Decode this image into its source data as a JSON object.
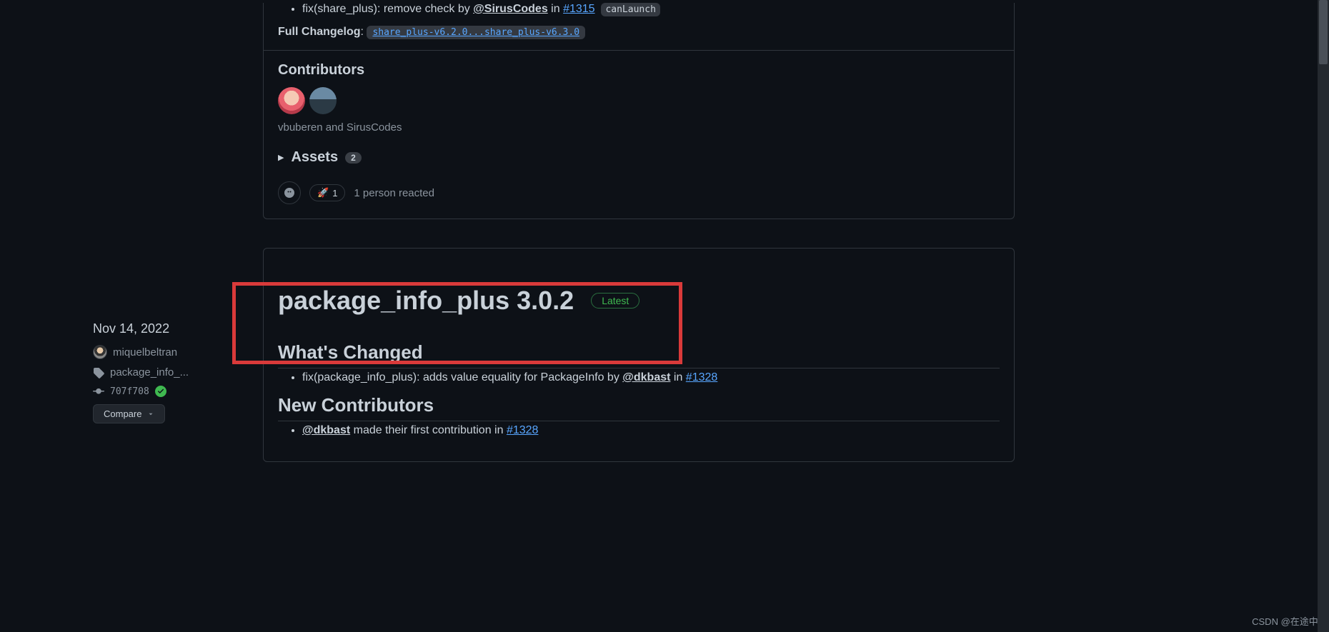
{
  "prev_release": {
    "items": [
      {
        "prefix": "fix(share_plus): remove check by ",
        "mention": "@SirusCodes",
        "in": " in ",
        "pr": "#1315",
        "chip": "canLaunch"
      }
    ],
    "changelog_label": "Full Changelog",
    "changelog_compare": "share_plus-v6.2.0...share_plus-v6.3.0",
    "contributors_heading": "Contributors",
    "contributors_names": "vbuberen and SirusCodes",
    "assets_label": "Assets",
    "assets_count": "2",
    "reaction_emoji": "🚀",
    "reaction_count": "1",
    "reaction_summary": "1 person reacted"
  },
  "sidebar": {
    "date": "Nov 14, 2022",
    "author": "miquelbeltran",
    "tag": "package_info_...",
    "sha": "707f708",
    "compare_label": "Compare"
  },
  "release": {
    "title": "package_info_plus 3.0.2",
    "latest_label": "Latest",
    "whats_changed": "What's Changed",
    "changed_items": [
      {
        "prefix": "fix(package_info_plus): adds value equality for PackageInfo by ",
        "mention": "@dkbast",
        "in": " in ",
        "pr": "#1328"
      }
    ],
    "new_contributors": "New Contributors",
    "newcontrib_items": [
      {
        "mention": "@dkbast",
        "mid": " made their first contribution in ",
        "pr": "#1328"
      }
    ]
  },
  "watermark": "CSDN @在途中.."
}
